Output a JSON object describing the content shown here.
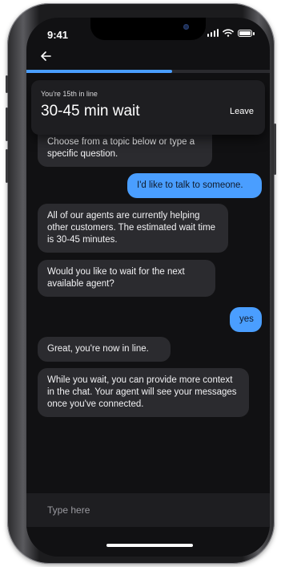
{
  "status_bar": {
    "time": "9:41"
  },
  "header": {
    "back_icon": "arrow-left-icon",
    "progress_fraction": 0.6
  },
  "queue": {
    "position_text": "You're 15th in line",
    "wait_text": "30-45 min wait",
    "leave_label": "Leave"
  },
  "messages": [
    {
      "sender": "agent",
      "text": "Choose from a topic below or type a specific question."
    },
    {
      "sender": "user",
      "text": "I'd like to talk to someone."
    },
    {
      "sender": "agent",
      "text": "All of our agents are currently helping other customers. The estimated wait time is 30-45 minutes."
    },
    {
      "sender": "agent",
      "text": "Would you like to wait for the next available agent?"
    },
    {
      "sender": "user",
      "text": "yes"
    },
    {
      "sender": "agent",
      "text": "Great, you're now in line."
    },
    {
      "sender": "agent",
      "text": "While you wait, you can provide more context in the chat. Your agent will see your messages once you've connected."
    }
  ],
  "composer": {
    "placeholder": "Type here"
  },
  "colors": {
    "accent": "#4a9eff",
    "background": "#111113",
    "agent_bubble": "#2b2b2f",
    "card": "#1e1e21"
  }
}
